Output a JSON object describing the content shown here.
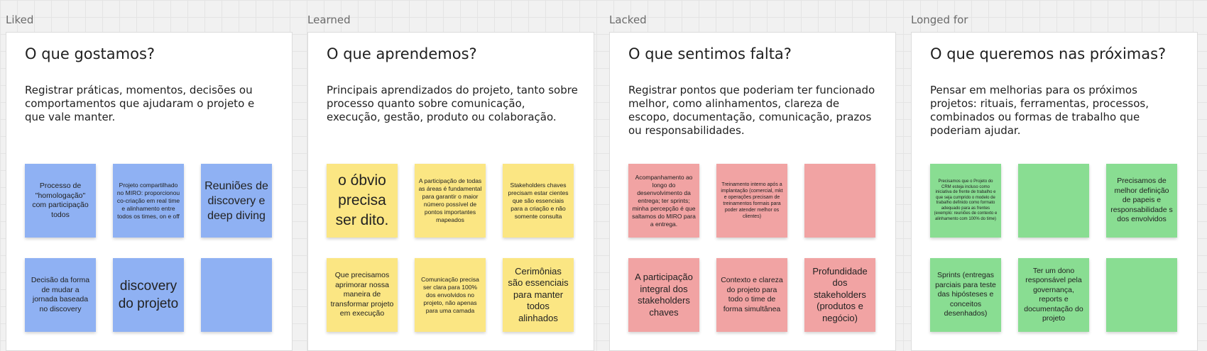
{
  "columns": [
    {
      "label": "Liked",
      "title": "O que gostamos?",
      "description": "Registrar práticas, momentos, decisões ou comportamentos que ajudaram o projeto e que vale manter.",
      "color": "#8fb1f3",
      "notes": [
        "Processo de \"homologação\" com participação todos",
        "Projeto compartilhado no MIRO: proporcionou co-criação em real time e alinhamento entre todos os times, on e off",
        "Reuniões de discovery e deep diving",
        "Decisão da forma de mudar a jornada baseada no discovery",
        "discovery do projeto",
        ""
      ]
    },
    {
      "label": "Learned",
      "title": "O que aprendemos?",
      "description": "Principais aprendizados do projeto, tanto sobre processo quanto sobre comunicação, execução, gestão, produto ou colaboração.",
      "color": "#fbe683",
      "notes": [
        "o óbvio precisa ser dito.",
        "A participação de todas as áreas é fundamental para garantir o maior número possível de pontos importantes mapeados",
        "Stakeholders chaves precisam estar cientes que são essenciais para a criação e não somente consulta",
        "Que precisamos aprimorar nossa maneira de transformar projeto em execução",
        "Comunicação precisa ser clara para 100% dos envolvidos no projeto, não apenas para uma camada",
        "Cerimônias são essenciais para manter todos alinhados"
      ]
    },
    {
      "label": "Lacked",
      "title": "O que sentimos falta?",
      "description": "Registrar pontos que poderiam ter funcionado melhor, como alinhamentos, clareza de escopo, documentação, comunicação, prazos ou responsabilidades.",
      "color": "#f1a3a3",
      "notes": [
        "Acompanhamento ao longo do desenvolvimento da entrega; ter sprints; minha percepção é que saltamos do MIRO para a entrega.",
        "Treinamento interno após a implantação (comercial, mkt e operações precisam de treinamentos formais para poder atender melhor os clientes)",
        "",
        "A participação integral dos stakeholders chaves",
        "Contexto e clareza do projeto para todo o time de forma simultânea",
        "Profundidade dos stakeholders (produtos e negócio)"
      ]
    },
    {
      "label": "Longed for",
      "title": "O que queremos nas próximas?",
      "description": "Pensar em melhorias para os próximos projetos: rituais, ferramentas, processos, combinados ou formas de trabalho que poderiam ajudar.",
      "color": "#89dd92",
      "notes": [
        "Precisamos que o Projeto do CRM esteja incluso como iniciativa de frente de trabalho e que seja cumprido o modelo de trabalho definido como formato adequado para as frentes (exemplo: reuniões de contexto e alinhamento com 100% do time)",
        "",
        "Precisamos de melhor definição de papeis e responsabilidade s dos envolvidos",
        "Sprints (entregas parciais para teste das hipósteses e conceitos desenhados)",
        "Ter um dono responsável pela governança, reports e documentação do projeto",
        ""
      ]
    }
  ]
}
